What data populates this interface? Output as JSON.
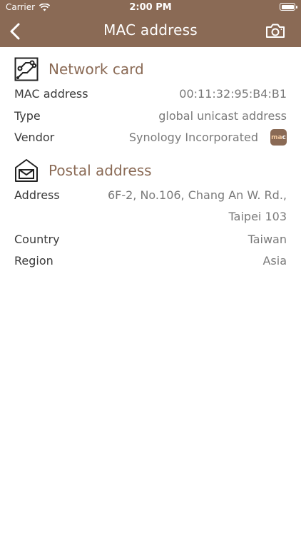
{
  "status_bar": {
    "carrier": "Carrier",
    "time": "2:00 PM",
    "battery_level": 1.0
  },
  "nav": {
    "title": "MAC address",
    "back_icon": "chevron-left-icon",
    "action_icon": "camera-icon"
  },
  "network_card": {
    "heading": "Network card",
    "rows": [
      {
        "label": "MAC address",
        "value": "00:11:32:95:B4:B1"
      },
      {
        "label": "Type",
        "value": "global unicast address"
      },
      {
        "label": "Vendor",
        "value": "Synology Incorporated"
      }
    ],
    "vendor_badge": {
      "text_a": "ma",
      "text_b": "c"
    }
  },
  "postal_address": {
    "heading": "Postal address",
    "rows": [
      {
        "label": "Address",
        "value_line1": "6F-2, No.106, Chang An W. Rd.,",
        "value_line2": "Taipei 103"
      },
      {
        "label": "Country",
        "value": "Taiwan"
      },
      {
        "label": "Region",
        "value": "Asia"
      }
    ]
  },
  "colors": {
    "accent": "#8a6a55",
    "text": "#3a3a3a",
    "value_text": "#7a7a7a",
    "background": "#ffffff"
  }
}
